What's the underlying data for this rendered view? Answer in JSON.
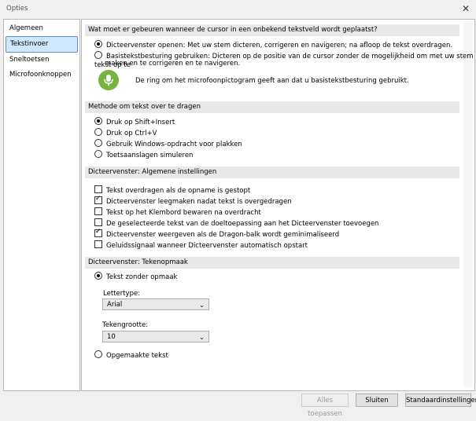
{
  "window": {
    "title": "Opties"
  },
  "sidebar": {
    "items": [
      {
        "label": "Algemeen"
      },
      {
        "label": "Tekstinvoer"
      },
      {
        "label": "Sneltoetsen"
      },
      {
        "label": "Microfoonknoppen"
      }
    ]
  },
  "sections": {
    "cursor": {
      "header": "Wat moet er gebeuren wanneer de cursor in een onbekend tekstveld wordt geplaatst?",
      "option1": "Dicteervenster openen: Met uw stem dicteren, corrigeren en navigeren; na afloop de tekst overdragen.",
      "option2_line1": "Basistekstbesturing gebruiken: Dicteren op de positie van de cursor zonder de mogelijkheid om met uw stem tekst op te",
      "option2_line2": "maken en te corrigeren en te navigeren.",
      "mic_note": "De ring om het microfoonpictogram geeft aan dat u basistekstbesturing gebruikt."
    },
    "method": {
      "header": "Methode om tekst over te dragen",
      "options": [
        "Druk op Shift+Insert",
        "Druk op Ctrl+V",
        "Gebruik Windows-opdracht voor plakken",
        "Toetsaanslagen simuleren"
      ]
    },
    "general": {
      "header": "Dicteervenster: Algemene instellingen",
      "options": [
        "Tekst overdragen als de opname is gestopt",
        "Dicteervenster leegmaken nadat tekst is overgedragen",
        "Tekst op het Klembord bewaren na overdracht",
        "De geselecteerde tekst van de doeltoepassing aan het Dicteervenster toevoegen",
        "Dicteervenster weergeven als de Dragon-balk wordt geminimaliseerd",
        "Geluidssignaal wanneer Dicteervenster automatisch opstart"
      ],
      "checked": [
        false,
        true,
        false,
        false,
        true,
        false
      ]
    },
    "format": {
      "header": "Dicteervenster: Tekenopmaak",
      "plain": "Tekst zonder opmaak",
      "font_label": "Lettertype:",
      "font_value": "Arial",
      "size_label": "Tekengrootte:",
      "size_value": "10",
      "formatted": "Opgemaakte tekst"
    }
  },
  "buttons": {
    "apply": "Alles toepassen",
    "close": "Sluiten",
    "defaults": "Standaardinstellingen"
  }
}
